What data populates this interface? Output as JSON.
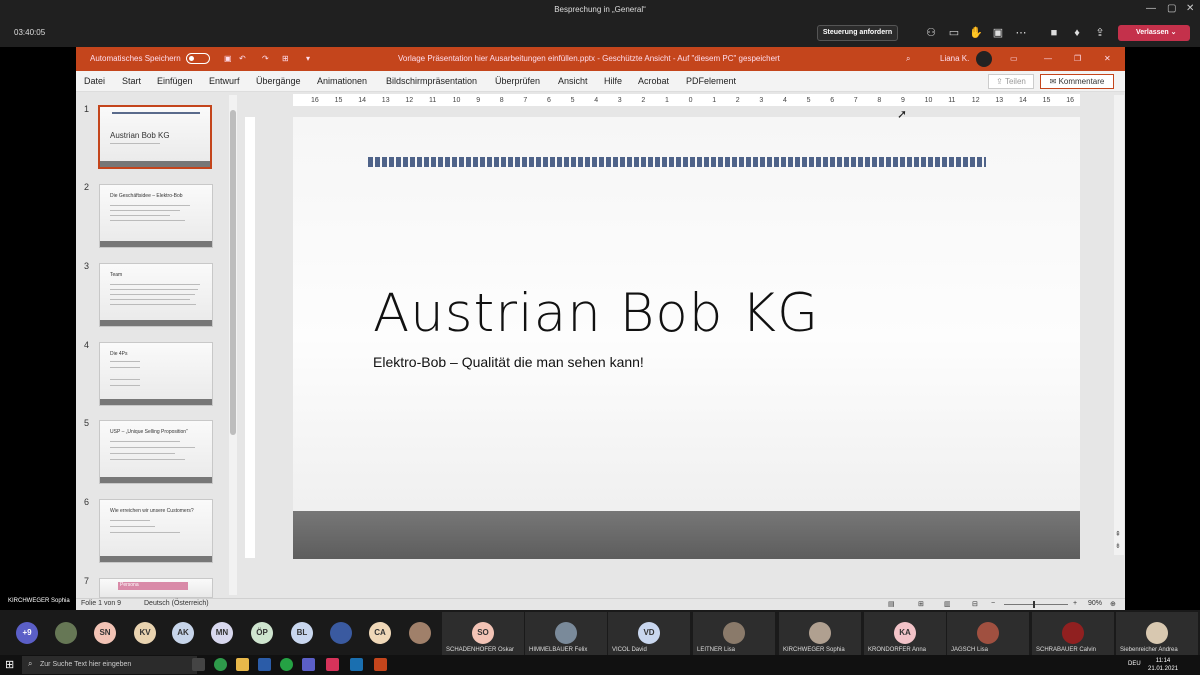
{
  "teams": {
    "meeting_title": "Besprechung in „General“",
    "timer": "03:40:05",
    "control_request": "Steuerung anfordern",
    "leave_label": "Verlassen",
    "self_label": "KIRCHWEGER Sophia"
  },
  "ppt": {
    "autosave_label": "Automatisches Speichern",
    "doc_title": "Vorlage Präsentation hier Ausarbeitungen einfüllen.pptx  -  Geschützte Ansicht  -  Auf \"diesem PC\" gespeichert",
    "user_name": "Liana K.",
    "menu": [
      "Datei",
      "Start",
      "Einfügen",
      "Entwurf",
      "Übergänge",
      "Animationen",
      "Bildschirmpräsentation",
      "Überprüfen",
      "Ansicht",
      "Hilfe",
      "Acrobat",
      "PDFelement"
    ],
    "share_label": "Teilen",
    "comments_label": "Kommentare",
    "ruler_ticks": [
      "16",
      "15",
      "14",
      "13",
      "12",
      "11",
      "10",
      "9",
      "8",
      "7",
      "6",
      "5",
      "4",
      "3",
      "2",
      "1",
      "0",
      "1",
      "2",
      "3",
      "4",
      "5",
      "6",
      "7",
      "8",
      "9",
      "10",
      "11",
      "12",
      "13",
      "14",
      "15",
      "16"
    ],
    "status_slide": "Folie 1 von 9",
    "status_lang": "Deutsch (Österreich)",
    "zoom": "90%"
  },
  "slides": [
    {
      "num": "1",
      "title": "Austrian Bob KG"
    },
    {
      "num": "2",
      "title": "Die Geschäftsidee – Elektro-Bob"
    },
    {
      "num": "3",
      "title": "Team"
    },
    {
      "num": "4",
      "title": "Die 4Ps"
    },
    {
      "num": "5",
      "title": "USP – „Unique Selling Proposition“"
    },
    {
      "num": "6",
      "title": "Wie erreichen wir unsere Customers?"
    },
    {
      "num": "7",
      "title": "Persona"
    }
  ],
  "main_slide": {
    "title": "Austrian Bob KG",
    "subtitle": "Elektro-Bob – Qualität die man sehen kann!"
  },
  "participants_circles": [
    {
      "initials": "+9",
      "color": "#5b5fc7"
    },
    {
      "initials": "",
      "color": "#667755"
    },
    {
      "initials": "SN",
      "color": "#f2c3b5"
    },
    {
      "initials": "KV",
      "color": "#e9d3b0"
    },
    {
      "initials": "AK",
      "color": "#c7d5ea"
    },
    {
      "initials": "MN",
      "color": "#d8d8ee"
    },
    {
      "initials": "ÖP",
      "color": "#cfe5cf"
    },
    {
      "initials": "BL",
      "color": "#c9d7ef"
    },
    {
      "initials": "",
      "color": "#3a5aa0"
    },
    {
      "initials": "CA",
      "color": "#f0d8b8"
    },
    {
      "initials": "",
      "color": "#a0806a"
    }
  ],
  "participant_tiles": [
    {
      "initials": "SO",
      "name": "SCHADENHOFER Oskar",
      "color": "#f2c3b5"
    },
    {
      "initials": "",
      "name": "HIMMELBAUER Felix",
      "color": "#7a8a9a"
    },
    {
      "initials": "VD",
      "name": "VICOL David",
      "color": "#c9d7ef"
    },
    {
      "initials": "",
      "name": "LEITNER Lisa",
      "color": "#8a7a6a"
    },
    {
      "initials": "",
      "name": "KIRCHWEGER Sophia",
      "color": "#b0a090"
    },
    {
      "initials": "KA",
      "name": "KRONDORFER Anna",
      "color": "#f2c3c8"
    },
    {
      "initials": "",
      "name": "JAGSCH Lisa",
      "color": "#a05040"
    },
    {
      "initials": "",
      "name": "SCHRABAUER Calvin",
      "color": "#902020"
    },
    {
      "initials": "",
      "name": "Siebenreicher Andrea",
      "color": "#d8c8b0"
    }
  ],
  "taskbar": {
    "search_placeholder": "Zur Suche Text hier eingeben",
    "lang": "DEU",
    "time": "11:14",
    "date": "21.01.2021"
  }
}
